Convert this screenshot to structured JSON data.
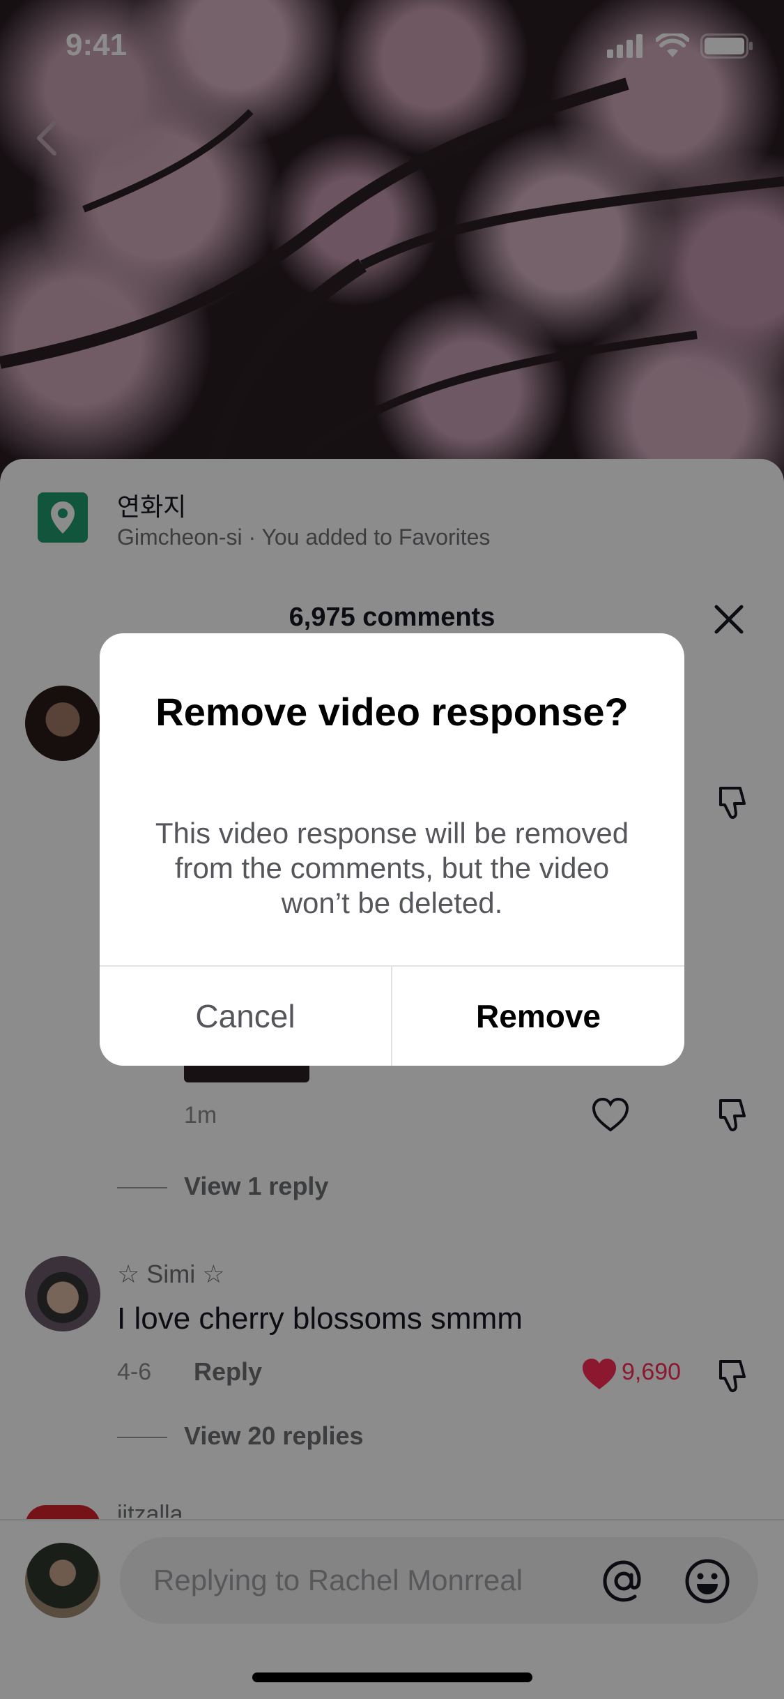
{
  "status_bar": {
    "time": "9:41"
  },
  "location": {
    "name": "연화지",
    "subtitle": "Gimcheon-si · You added to Favorites"
  },
  "comments": {
    "count_label": "6,975 comments",
    "items": [
      {
        "time": "1m",
        "view_replies": "View 1 reply"
      },
      {
        "name": "Simi",
        "text": "I love cherry blossoms smmm",
        "date": "4-6",
        "reply_label": "Reply",
        "likes": "9,690",
        "view_replies": "View 20 replies"
      },
      {
        "name": "jjtzalla"
      }
    ]
  },
  "input": {
    "placeholder": "Replying to Rachel Monrreal"
  },
  "dialog": {
    "title": "Remove video response?",
    "message": "This video response will be removed from the comments, but the video won’t be deleted.",
    "cancel_label": "Cancel",
    "confirm_label": "Remove"
  },
  "colors": {
    "location_icon": "#1f9b6f",
    "like_active": "#fe2c55",
    "dim_overlay": "rgba(0,0,0,0.45)"
  }
}
